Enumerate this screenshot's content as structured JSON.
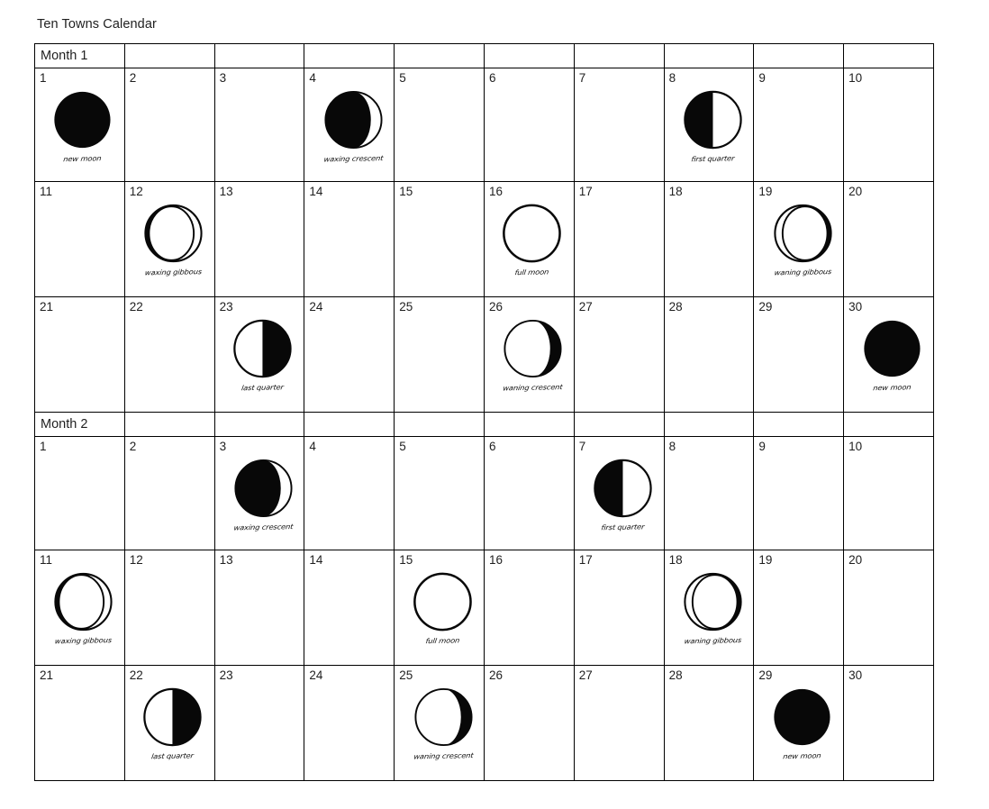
{
  "page": {
    "title": "Ten Towns Calendar"
  },
  "legend": {
    "phase_names": {
      "new-moon": "new moon",
      "waxing-crescent": "waxing crescent",
      "first-quarter": "first quarter",
      "waxing-gibbous": "waxing gibbous",
      "full-moon": "full moon",
      "waning-gibbous": "waning gibbous",
      "last-quarter": "last quarter",
      "waning-crescent": "waning crescent"
    }
  },
  "colors": {
    "ink": "#000000",
    "paper": "#ffffff",
    "text": "#1f1f1f",
    "grid": "#000000"
  },
  "months": [
    {
      "header": "Month 1",
      "weeks": [
        {
          "days": [
            {
              "number": "1",
              "phase": "new-moon",
              "caption": "new moon"
            },
            {
              "number": "2",
              "phase": null,
              "caption": ""
            },
            {
              "number": "3",
              "phase": null,
              "caption": ""
            },
            {
              "number": "4",
              "phase": "waxing-crescent",
              "caption": "waxing crescent"
            },
            {
              "number": "5",
              "phase": null,
              "caption": ""
            },
            {
              "number": "6",
              "phase": null,
              "caption": ""
            },
            {
              "number": "7",
              "phase": null,
              "caption": ""
            },
            {
              "number": "8",
              "phase": "first-quarter",
              "caption": "first quarter"
            },
            {
              "number": "9",
              "phase": null,
              "caption": ""
            },
            {
              "number": "10",
              "phase": null,
              "caption": ""
            }
          ]
        },
        {
          "days": [
            {
              "number": "11",
              "phase": null,
              "caption": ""
            },
            {
              "number": "12",
              "phase": "waxing-gibbous",
              "caption": "waxing gibbous"
            },
            {
              "number": "13",
              "phase": null,
              "caption": ""
            },
            {
              "number": "14",
              "phase": null,
              "caption": ""
            },
            {
              "number": "15",
              "phase": null,
              "caption": ""
            },
            {
              "number": "16",
              "phase": "full-moon",
              "caption": "full moon"
            },
            {
              "number": "17",
              "phase": null,
              "caption": ""
            },
            {
              "number": "18",
              "phase": null,
              "caption": ""
            },
            {
              "number": "19",
              "phase": "waning-gibbous",
              "caption": "waning gibbous"
            },
            {
              "number": "20",
              "phase": null,
              "caption": ""
            }
          ]
        },
        {
          "days": [
            {
              "number": "21",
              "phase": null,
              "caption": ""
            },
            {
              "number": "22",
              "phase": null,
              "caption": ""
            },
            {
              "number": "23",
              "phase": "last-quarter",
              "caption": "last quarter"
            },
            {
              "number": "24",
              "phase": null,
              "caption": ""
            },
            {
              "number": "25",
              "phase": null,
              "caption": ""
            },
            {
              "number": "26",
              "phase": "waning-crescent",
              "caption": "waning crescent"
            },
            {
              "number": "27",
              "phase": null,
              "caption": ""
            },
            {
              "number": "28",
              "phase": null,
              "caption": ""
            },
            {
              "number": "29",
              "phase": null,
              "caption": ""
            },
            {
              "number": "30",
              "phase": "new-moon",
              "caption": "new moon"
            }
          ]
        }
      ]
    },
    {
      "header": "Month 2",
      "weeks": [
        {
          "days": [
            {
              "number": "1",
              "phase": null,
              "caption": ""
            },
            {
              "number": "2",
              "phase": null,
              "caption": ""
            },
            {
              "number": "3",
              "phase": "waxing-crescent",
              "caption": "waxing crescent"
            },
            {
              "number": "4",
              "phase": null,
              "caption": ""
            },
            {
              "number": "5",
              "phase": null,
              "caption": ""
            },
            {
              "number": "6",
              "phase": null,
              "caption": ""
            },
            {
              "number": "7",
              "phase": "first-quarter",
              "caption": "first quarter"
            },
            {
              "number": "8",
              "phase": null,
              "caption": ""
            },
            {
              "number": "9",
              "phase": null,
              "caption": ""
            },
            {
              "number": "10",
              "phase": null,
              "caption": ""
            }
          ]
        },
        {
          "days": [
            {
              "number": "11",
              "phase": "waxing-gibbous",
              "caption": "waxing gibbous"
            },
            {
              "number": "12",
              "phase": null,
              "caption": ""
            },
            {
              "number": "13",
              "phase": null,
              "caption": ""
            },
            {
              "number": "14",
              "phase": null,
              "caption": ""
            },
            {
              "number": "15",
              "phase": "full-moon",
              "caption": "full moon"
            },
            {
              "number": "16",
              "phase": null,
              "caption": ""
            },
            {
              "number": "17",
              "phase": null,
              "caption": ""
            },
            {
              "number": "18",
              "phase": "waning-gibbous",
              "caption": "waning gibbous"
            },
            {
              "number": "19",
              "phase": null,
              "caption": ""
            },
            {
              "number": "20",
              "phase": null,
              "caption": ""
            }
          ]
        },
        {
          "days": [
            {
              "number": "21",
              "phase": null,
              "caption": ""
            },
            {
              "number": "22",
              "phase": "last-quarter",
              "caption": "last quarter"
            },
            {
              "number": "23",
              "phase": null,
              "caption": ""
            },
            {
              "number": "24",
              "phase": null,
              "caption": ""
            },
            {
              "number": "25",
              "phase": "waning-crescent",
              "caption": "waning crescent"
            },
            {
              "number": "26",
              "phase": null,
              "caption": ""
            },
            {
              "number": "27",
              "phase": null,
              "caption": ""
            },
            {
              "number": "28",
              "phase": null,
              "caption": ""
            },
            {
              "number": "29",
              "phase": "new-moon",
              "caption": "new moon"
            },
            {
              "number": "30",
              "phase": null,
              "caption": ""
            }
          ]
        }
      ]
    }
  ]
}
